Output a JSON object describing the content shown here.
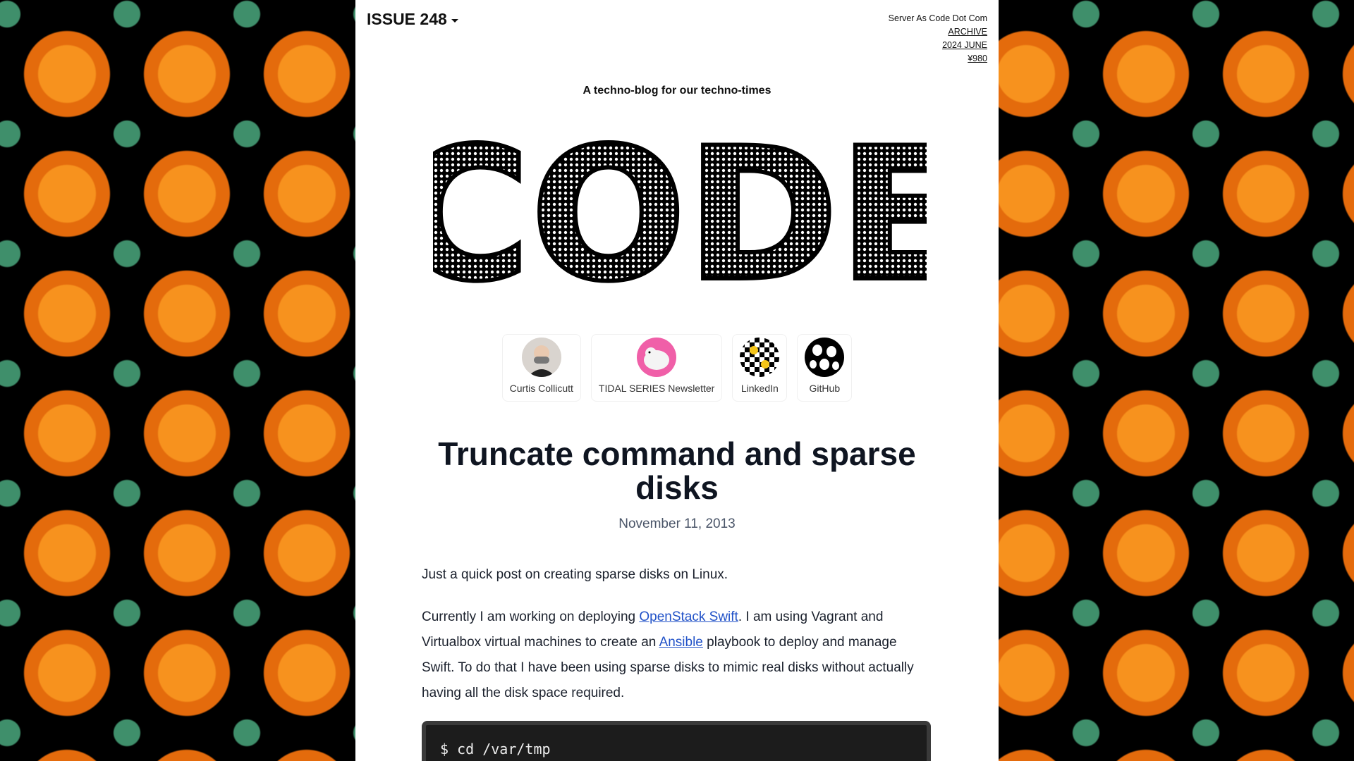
{
  "header": {
    "issue_label": "ISSUE 248",
    "site_name": "Server As Code Dot Com",
    "archive_link": "ARCHIVE",
    "edition_link": "2024 JUNE",
    "price_link": "¥980"
  },
  "tagline": "A techno-blog for our techno-times",
  "logo_text": "CODE",
  "profile_links": [
    {
      "label": "Curtis Collicutt",
      "icon": "person-avatar"
    },
    {
      "label": "TIDAL SERIES Newsletter",
      "icon": "polar-bear-avatar"
    },
    {
      "label": "LinkedIn",
      "icon": "checker-smiley-avatar"
    },
    {
      "label": "GitHub",
      "icon": "ghost-pattern-avatar"
    }
  ],
  "post": {
    "title": "Truncate command and sparse disks",
    "date": "November 11, 2013",
    "para1": "Just a quick post on creating sparse disks on Linux.",
    "para2_a": "Currently I am working on deploying ",
    "para2_link1": "OpenStack Swift",
    "para2_b": ". I am using Vagrant and Virtualbox virtual machines to create an ",
    "para2_link2": "Ansible",
    "para2_c": " playbook to deploy and manage Swift. To do that I have been using sparse disks to mimic real disks without actually having all the disk space required.",
    "code": "$ cd /var/tmp"
  },
  "colors": {
    "background": "#000000",
    "page": "#ffffff",
    "link": "#2152c8",
    "orange": "#f7921e",
    "leaf": "#3f8f6b"
  }
}
